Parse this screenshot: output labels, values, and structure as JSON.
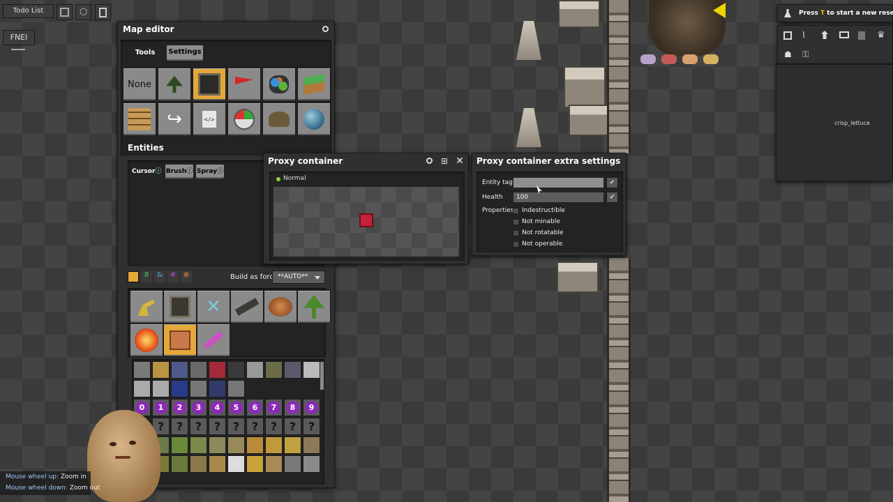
{
  "top_left": {
    "todo_label": "Todo List",
    "fnei_label": "FNEI",
    "icons": [
      "blueprint-book-icon",
      "crafting-icon",
      "calculator-icon"
    ]
  },
  "map_editor": {
    "title": "Map editor",
    "tabs": [
      {
        "label": "Tools",
        "active": false
      },
      {
        "label": "Settings",
        "active": true
      }
    ],
    "tool_none_label": "None",
    "tool_icons": [
      "tree-icon",
      "entity-tool-icon",
      "flag-icon",
      "resource-tool-icon",
      "tile-tool-icon",
      "decorative-tool-icon",
      "clone-arrow-icon",
      "script-icon",
      "time-clock-icon",
      "rock-icon",
      "planet-icon"
    ],
    "entities_label": "Entities",
    "modes": [
      {
        "label": "Cursor",
        "active": true
      },
      {
        "label": "Brush",
        "active": false
      },
      {
        "label": "Spray",
        "active": false
      }
    ],
    "build_as_force_label": "Build as force:",
    "force_value": "**AUTO**",
    "entity_icons": [
      "turret-icon",
      "proxy-container-icon",
      "lab-icon",
      "gun-icon",
      "spawner-icon",
      "tree-icon",
      "explosion-icon",
      "chest-icon",
      "hammer-icon"
    ],
    "digits": [
      "0",
      "1",
      "2",
      "3",
      "4",
      "5",
      "6",
      "7",
      "8",
      "9"
    ],
    "unknown_glyph": "?"
  },
  "proxy_container": {
    "title": "Proxy container",
    "status": "Normal",
    "status_color": "#8bd33a"
  },
  "extra_settings": {
    "title": "Proxy container extra settings",
    "entity_tag_label": "Entity tag",
    "entity_tag_value": "",
    "health_label": "Health",
    "health_value": "100",
    "properties_label": "Properties",
    "properties": [
      {
        "label": "Indestructible",
        "checked": false
      },
      {
        "label": "Not minable",
        "checked": false
      },
      {
        "label": "Not rotatable",
        "checked": false
      },
      {
        "label": "Not operable",
        "checked": false
      }
    ],
    "confirm_glyph": "✔"
  },
  "research": {
    "prefix": "Press ",
    "key": "T",
    "suffix": " to start a new research."
  },
  "right_panel": {
    "label": "crisp_lettuce"
  },
  "hints": [
    {
      "key": "Mouse wheel up:",
      "action": " Zoom in"
    },
    {
      "key": "Mouse wheel down:",
      "action": " Zoom out"
    }
  ],
  "colors": {
    "accent": "#e3a83a",
    "hint_key": "#9fc7f5",
    "research_key": "#f0b400"
  }
}
